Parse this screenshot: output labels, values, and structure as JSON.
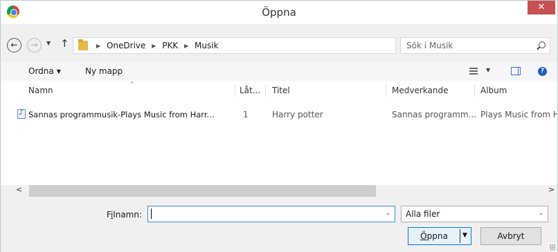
{
  "window": {
    "title": "Öppna",
    "close_glyph": "✕",
    "app_icon": "chrome-icon"
  },
  "nav": {
    "back_glyph": "←",
    "forward_glyph": "→",
    "recent_glyph": "▼",
    "up_glyph": "↑",
    "breadcrumb": [
      "OneDrive",
      "PKK",
      "Musik"
    ],
    "breadcrumb_sep": "▶",
    "address_dd_glyph": "⌄",
    "refresh_glyph": "↻"
  },
  "search": {
    "placeholder": "Sök i Musik"
  },
  "toolbar": {
    "organize_label": "Ordna",
    "new_folder_label": "Ny mapp",
    "dd_glyph": "▼",
    "help_glyph": "?"
  },
  "columns": {
    "name": "Namn",
    "track": "Låt...",
    "title": "Titel",
    "artists": "Medverkande",
    "album": "Album",
    "sort_glyph": "^"
  },
  "rows": [
    {
      "name": "Sannas programmusik-Plays Music from Harr...",
      "track": "1",
      "title": "Harry potter",
      "artists": "Sannas programm...",
      "album": "Plays Music from H"
    }
  ],
  "hscroll": {
    "left_glyph": "<",
    "right_glyph": ">"
  },
  "bottom": {
    "filename_label_pre": "F",
    "filename_label_accel": "i",
    "filename_label_post": "lnamn:",
    "filename_value": "",
    "filename_dd_glyph": "⌄",
    "filter_value": "Alla filer",
    "filter_dd_glyph": "⌄",
    "open_label_accel": "Ö",
    "open_label_post": "ppna",
    "open_dd_glyph": "▼",
    "cancel_label": "Avbryt"
  }
}
